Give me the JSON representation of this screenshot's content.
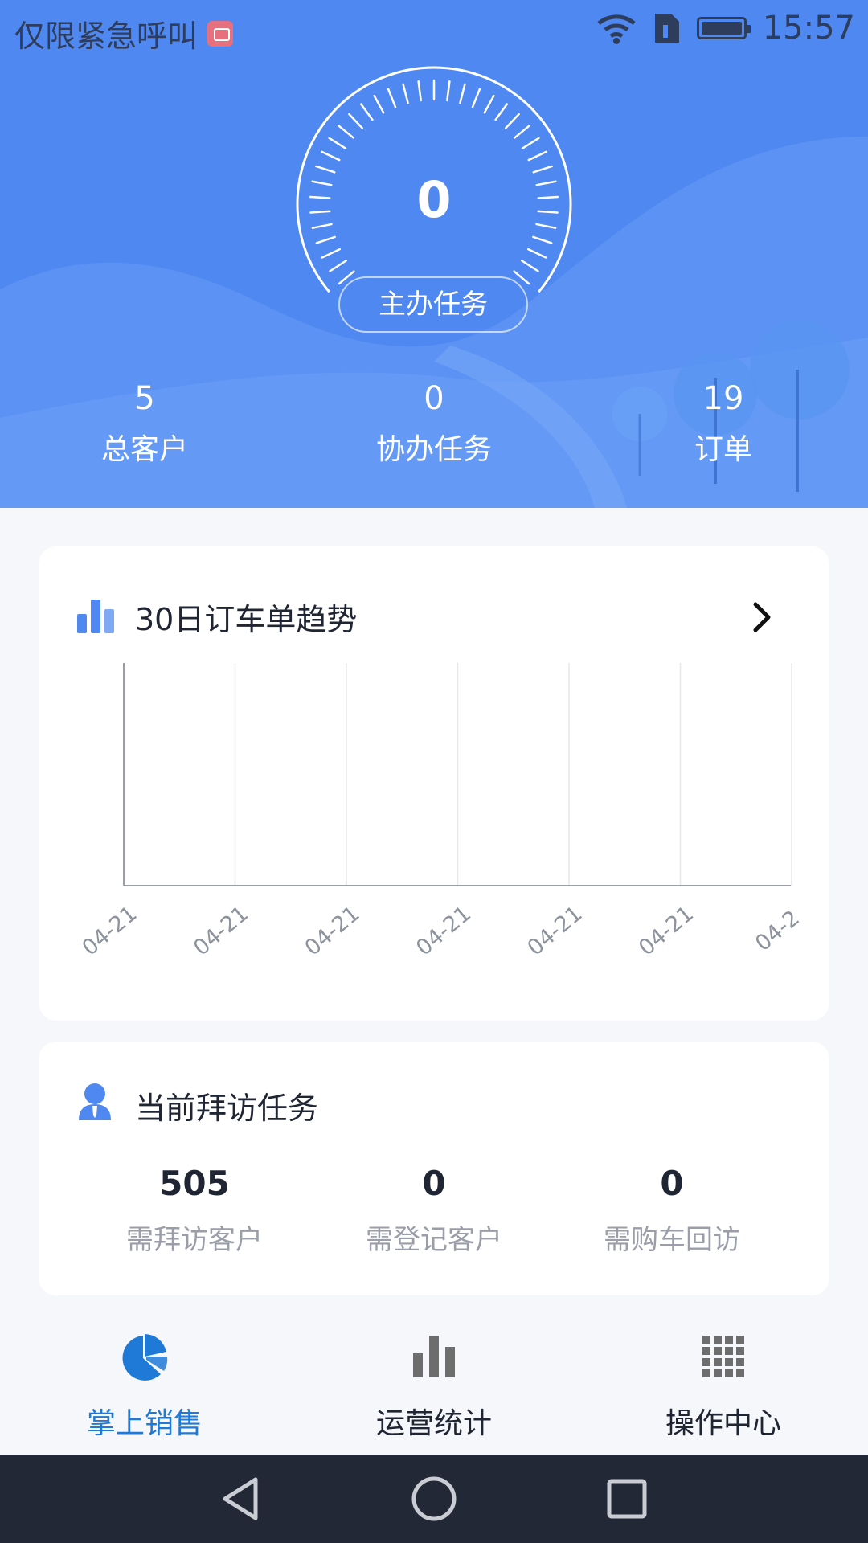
{
  "status_bar": {
    "carrier": "仅限紧急呼叫",
    "time": "15:57"
  },
  "header": {
    "gauge_value": "0",
    "gauge_label": "主办任务",
    "stats": [
      {
        "value": "5",
        "label": "总客户"
      },
      {
        "value": "0",
        "label": "协办任务"
      },
      {
        "value": "19",
        "label": "订单"
      }
    ]
  },
  "trend_card": {
    "title": "30日订车单趋势",
    "chart_data": {
      "type": "bar",
      "categories": [
        "04-21",
        "04-21",
        "04-21",
        "04-21",
        "04-21",
        "04-21",
        "04-2"
      ],
      "values": [],
      "title": "",
      "xlabel": "",
      "ylabel": "",
      "grid": true
    }
  },
  "visit_card": {
    "title": "当前拜访任务",
    "stats": [
      {
        "value": "505",
        "label": "需拜访客户"
      },
      {
        "value": "0",
        "label": "需登记客户"
      },
      {
        "value": "0",
        "label": "需购车回访"
      }
    ]
  },
  "tabbar": {
    "tabs": [
      {
        "label": "掌上销售",
        "icon": "pie-chart-icon",
        "active": true
      },
      {
        "label": "运营统计",
        "icon": "bar-chart-icon",
        "active": false
      },
      {
        "label": "操作中心",
        "icon": "grid-icon",
        "active": false
      }
    ]
  },
  "colors": {
    "header_blue": "#4f88f0",
    "accent": "#1e7ad6",
    "nav_bar": "#222835"
  }
}
